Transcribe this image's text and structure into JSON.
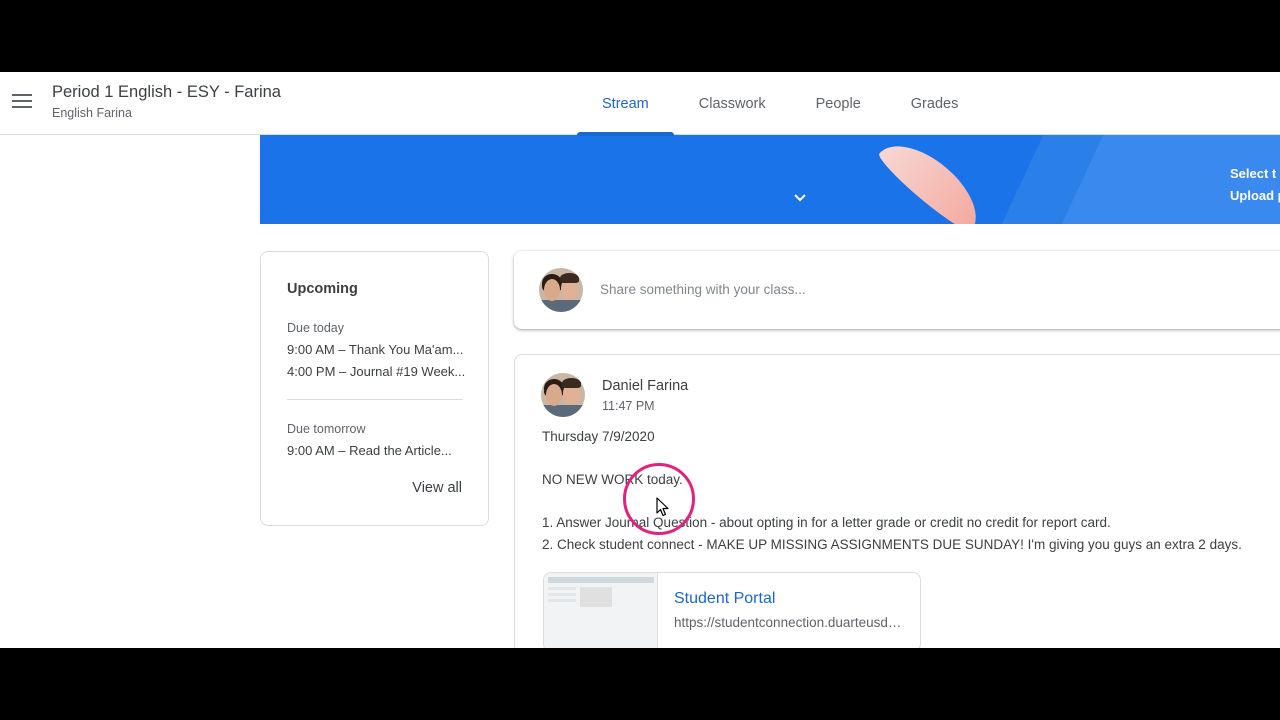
{
  "header": {
    "class_title": "Period 1 English - ESY - Farina",
    "class_subtitle": "English Farina",
    "tabs": [
      {
        "label": "Stream",
        "active": true
      },
      {
        "label": "Classwork",
        "active": false
      },
      {
        "label": "People",
        "active": false
      },
      {
        "label": "Grades",
        "active": false
      }
    ]
  },
  "banner": {
    "text_1": "Select t",
    "text_2": "Upload p",
    "color": "#1a73e8"
  },
  "upcoming": {
    "title": "Upcoming",
    "due_today_label": "Due today",
    "due_today_items": [
      "9:00 AM – Thank You Ma'am...",
      "4:00 PM – Journal #19 Week..."
    ],
    "due_tomorrow_label": "Due tomorrow",
    "due_tomorrow_items": [
      "9:00 AM – Read the Article..."
    ],
    "view_all_label": "View all"
  },
  "share": {
    "placeholder": "Share something with your class..."
  },
  "post": {
    "author": "Daniel Farina",
    "time": "11:47 PM",
    "lines": [
      "Thursday 7/9/2020",
      "NO NEW WORK today.",
      "1. Answer Journal Question - about opting in for a letter grade or credit no credit for report card.",
      "2. Check student connect - MAKE UP MISSING ASSIGNMENTS DUE SUNDAY! I'm giving you guys an extra 2 days."
    ],
    "attachment": {
      "title": "Student Portal",
      "url": "https://studentconnection.duarteusd.org"
    }
  },
  "colors": {
    "accent": "#1967d2",
    "cursor_ring": "#e2227a"
  }
}
